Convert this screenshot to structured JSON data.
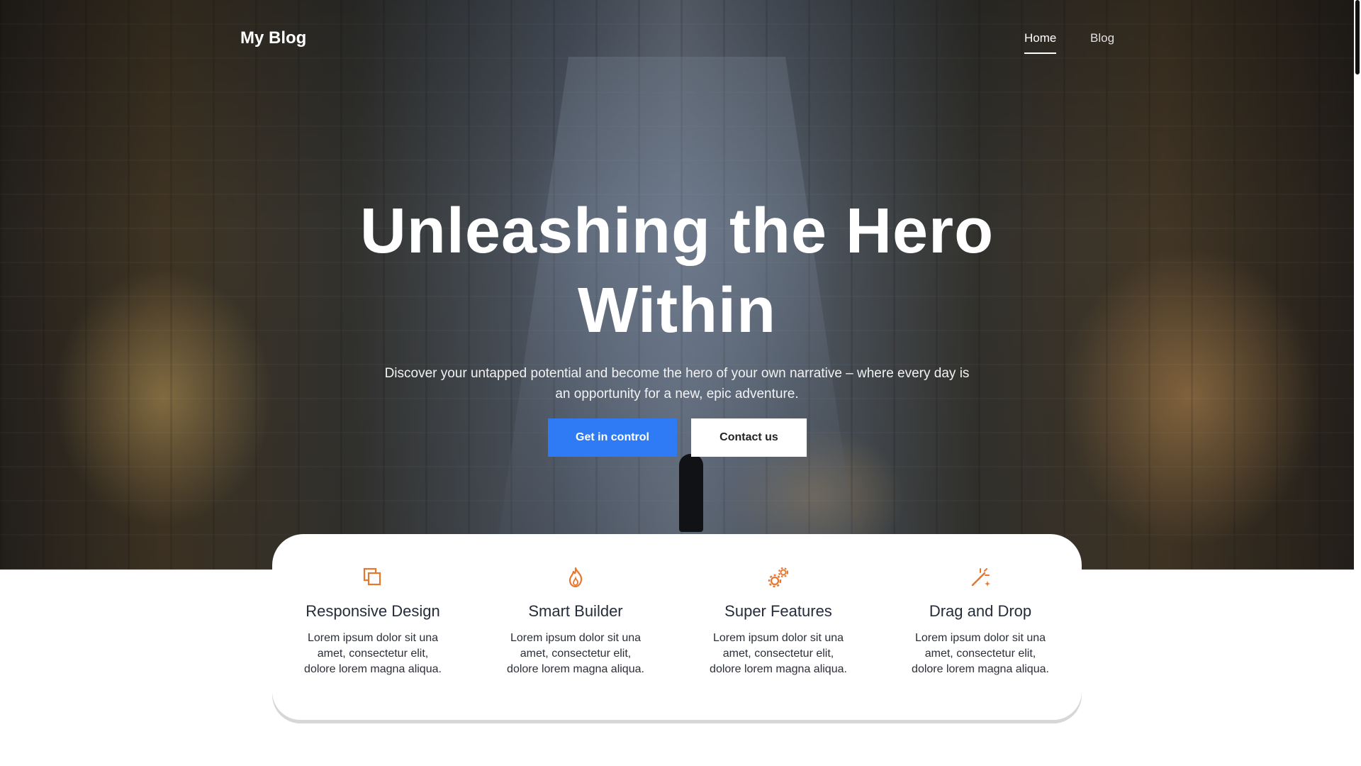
{
  "header": {
    "logo": "My Blog",
    "nav": [
      {
        "label": "Home",
        "active": true
      },
      {
        "label": "Blog",
        "active": false
      }
    ]
  },
  "hero": {
    "title_line1": "Unleashing the Hero",
    "title_line2": "Within",
    "subtitle": "Discover your untapped potential and become the hero of your own narrative – where every day is an opportunity for a new, epic adventure.",
    "primary_button": "Get in control",
    "secondary_button": "Contact us"
  },
  "features": [
    {
      "icon": "copy-icon",
      "title": "Responsive Design",
      "text": "Lorem ipsum dolor sit una amet, consectetur elit, dolore lorem magna aliqua."
    },
    {
      "icon": "fire-icon",
      "title": "Smart Builder",
      "text": "Lorem ipsum dolor sit una amet, consectetur elit, dolore lorem magna aliqua."
    },
    {
      "icon": "gears-icon",
      "title": "Super Features",
      "text": "Lorem ipsum dolor sit una amet, consectetur elit, dolore lorem magna aliqua."
    },
    {
      "icon": "magic-wand-icon",
      "title": "Drag and Drop",
      "text": "Lorem ipsum dolor sit una amet, consectetur elit, dolore lorem magna aliqua."
    }
  ],
  "colors": {
    "accent": "#2f7bf5",
    "icon": "#e8772e",
    "heading": "#252c3a"
  }
}
